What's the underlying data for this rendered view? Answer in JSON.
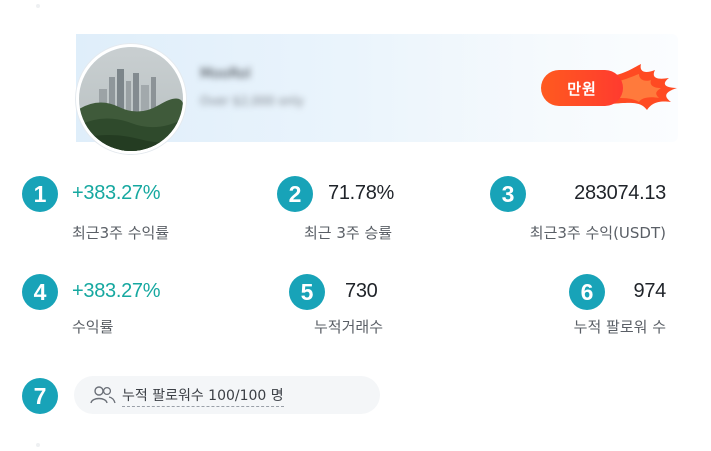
{
  "trader": {
    "name": "MooRol",
    "subtitle": "Over $2,000 only",
    "badge_label": "만원",
    "badge_colors": [
      "#ff5a1f",
      "#ff3b2f"
    ]
  },
  "stats": [
    {
      "index": "1",
      "value": "+383.27%",
      "label": "최근3주 수익률",
      "value_color": "#16a8a0"
    },
    {
      "index": "2",
      "value": "71.78%",
      "label": "최근 3주 승률",
      "value_color": "#1f2329"
    },
    {
      "index": "3",
      "value": "283074.13",
      "label": "최근3주 수익(USDT)",
      "value_color": "#1f2329"
    },
    {
      "index": "4",
      "value": "+383.27%",
      "label": "수익률",
      "value_color": "#16a8a0"
    },
    {
      "index": "5",
      "value": "730",
      "label": "누적거래수",
      "value_color": "#1f2329"
    },
    {
      "index": "6",
      "value": "974",
      "label": "누적 팔로워 수",
      "value_color": "#1f2329"
    }
  ],
  "followers": {
    "index": "7",
    "text": "누적 팔로워수 100/100 명",
    "icon": "users-icon"
  },
  "colors": {
    "accent_badge": "#18a3b8",
    "positive": "#16a8a0"
  }
}
